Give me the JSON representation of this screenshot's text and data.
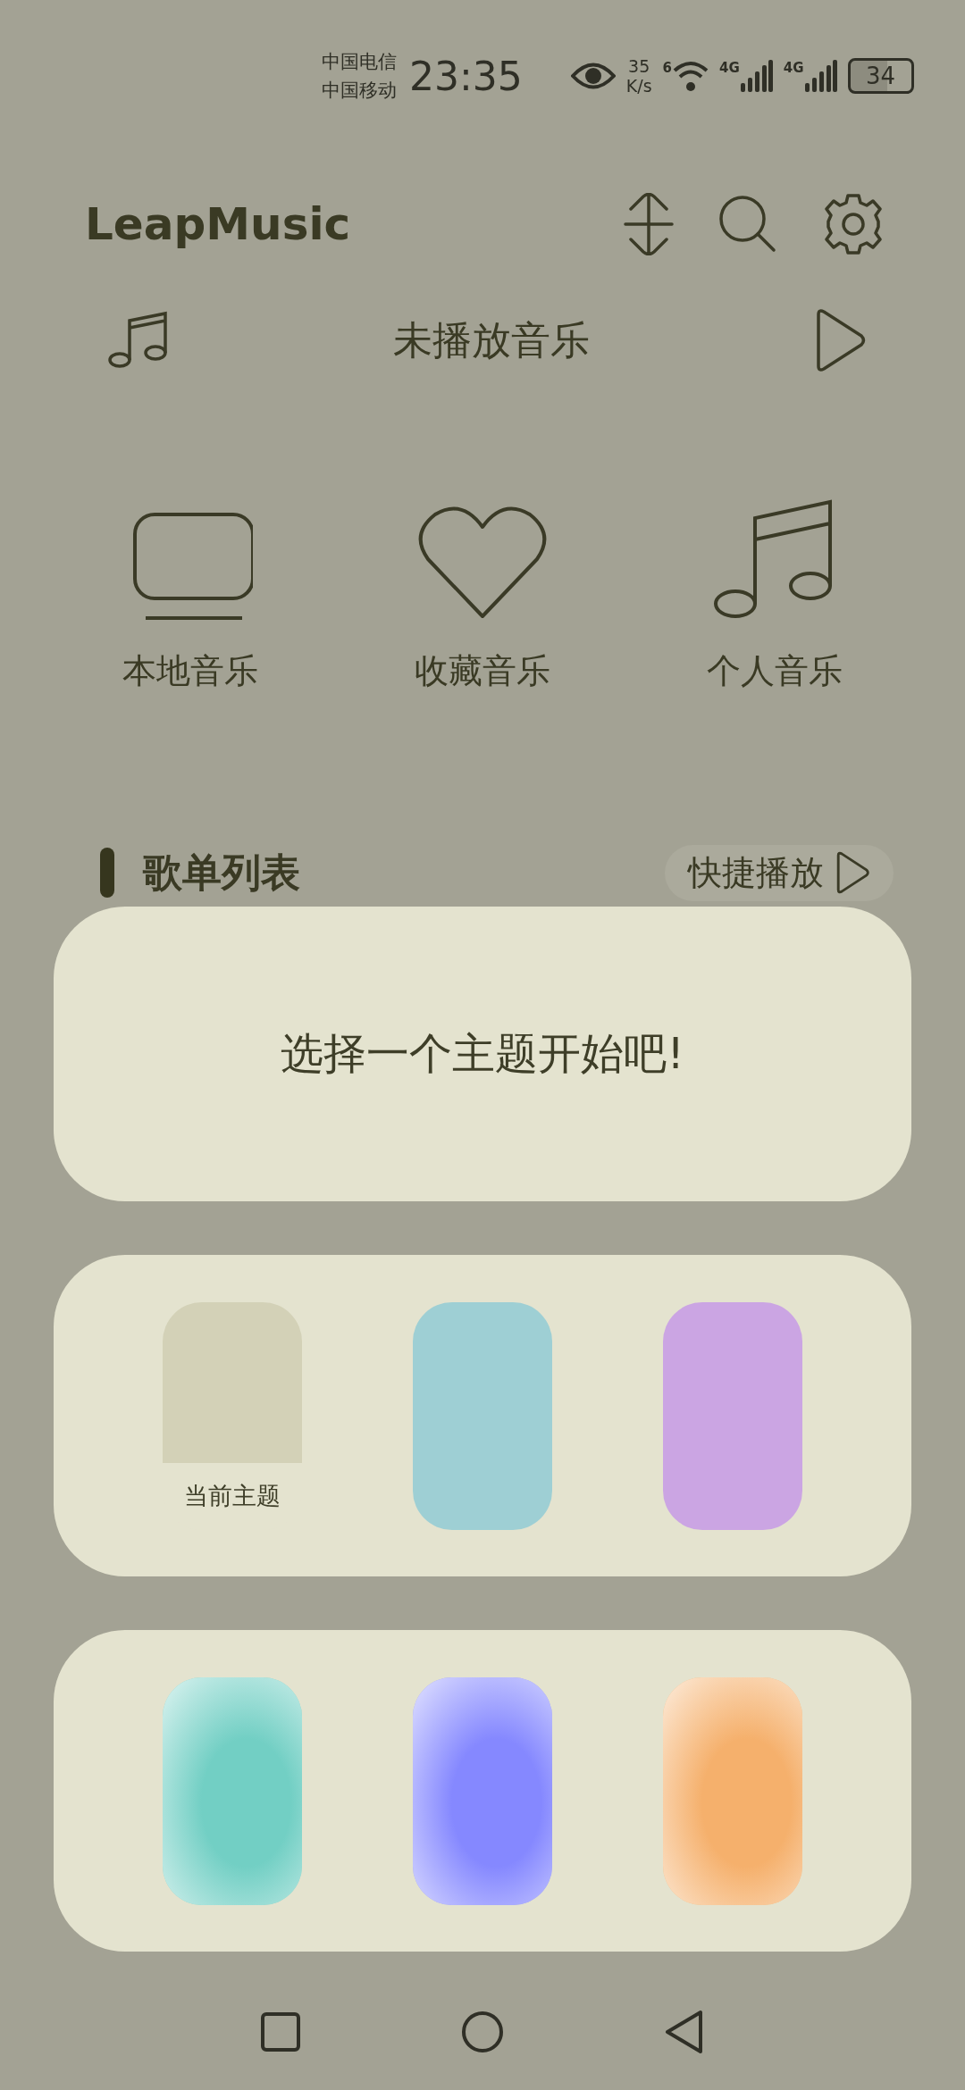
{
  "status_bar": {
    "carriers": [
      "中国电信",
      "中国移动"
    ],
    "time": "23:35",
    "speed_value": "35",
    "speed_unit": "K/s",
    "wifi_label": "6",
    "signals": [
      "4G",
      "4G"
    ],
    "battery": "34"
  },
  "header": {
    "title": "LeapMusic"
  },
  "now_playing": {
    "text": "未播放音乐"
  },
  "categories": [
    {
      "kind": "local",
      "label": "本地音乐"
    },
    {
      "kind": "favorite",
      "label": "收藏音乐"
    },
    {
      "kind": "personal",
      "label": "个人音乐"
    }
  ],
  "playlist_section": {
    "title": "歌单列表",
    "quick_play": "快捷播放"
  },
  "theme_dialog": {
    "prompt": "选择一个主题开始吧!",
    "theme_rows": [
      [
        {
          "kind": "solid",
          "color": "#d3d1b7",
          "selected": true,
          "label": "当前主题"
        },
        {
          "kind": "solid",
          "color": "#9ecfd4",
          "selected": false
        },
        {
          "kind": "solid",
          "color": "#cba5e3",
          "selected": false
        }
      ],
      [
        {
          "kind": "gradient",
          "color": "#72cfc4",
          "selected": false
        },
        {
          "kind": "gradient",
          "color": "#8588ff",
          "selected": false
        },
        {
          "kind": "gradient",
          "color": "#f5b06c",
          "selected": false
        }
      ]
    ]
  }
}
